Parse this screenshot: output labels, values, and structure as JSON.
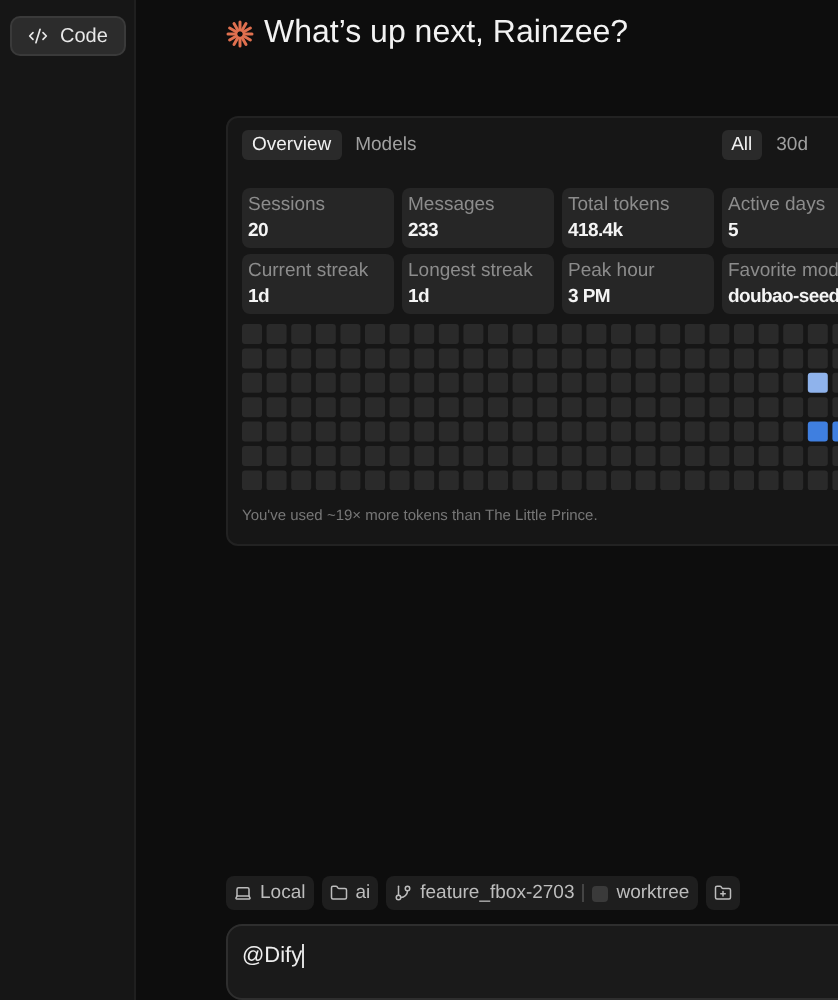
{
  "sidebar": {
    "items": [
      {
        "label": "Code",
        "selected": true
      }
    ]
  },
  "greeting": "What’s up next, Rainzee?",
  "usage": {
    "view_tabs": [
      {
        "label": "Overview",
        "selected": true
      },
      {
        "label": "Models",
        "selected": false
      }
    ],
    "range_tabs": [
      {
        "label": "All",
        "selected": true
      },
      {
        "label": "30d",
        "selected": false
      }
    ],
    "stats": [
      {
        "label": "Sessions",
        "value": "20"
      },
      {
        "label": "Messages",
        "value": "233"
      },
      {
        "label": "Total tokens",
        "value": "418.4k"
      },
      {
        "label": "Active days",
        "value": "5"
      },
      {
        "label": "Current streak",
        "value": "1d"
      },
      {
        "label": "Longest streak",
        "value": "1d"
      },
      {
        "label": "Peak hour",
        "value": "3 PM"
      },
      {
        "label": "Favorite mod",
        "value": "doubao-seed"
      }
    ],
    "footnote": "You've used ~19× more tokens than The Little Prince."
  },
  "context_chips": [
    {
      "kind": "local",
      "label": "Local"
    },
    {
      "kind": "folder",
      "label": "ai"
    },
    {
      "kind": "branch",
      "label": "feature_fbox-2703",
      "worktree": {
        "label": "worktree",
        "checked": false
      }
    },
    {
      "kind": "add-folder"
    }
  ],
  "composer": {
    "value": "@Dify"
  }
}
